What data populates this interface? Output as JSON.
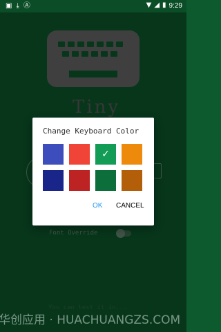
{
  "status_bar": {
    "time": "9:29",
    "left_icons": [
      "image-icon",
      "download-icon",
      "font-icon"
    ],
    "right_icons": [
      "wifi-icon",
      "signal-icon",
      "battery-icon"
    ]
  },
  "app": {
    "title": "Tiny",
    "font_override_label": "Font Override",
    "faint_text": "You can test it in..."
  },
  "watermark": "华创应用 · HUACHUANGZS.COM",
  "dialog": {
    "title": "Change Keyboard Color",
    "swatches": [
      {
        "color": "#3e4dbc",
        "selected": false
      },
      {
        "color": "#ef4437",
        "selected": false
      },
      {
        "color": "#129c56",
        "selected": true
      },
      {
        "color": "#ee8a0b",
        "selected": false
      },
      {
        "color": "#1a2589",
        "selected": false
      },
      {
        "color": "#be2323",
        "selected": false
      },
      {
        "color": "#0c6e3a",
        "selected": false
      },
      {
        "color": "#b35e08",
        "selected": false
      }
    ],
    "check_glyph": "✓",
    "ok_label": "OK",
    "cancel_label": "CANCEL"
  }
}
